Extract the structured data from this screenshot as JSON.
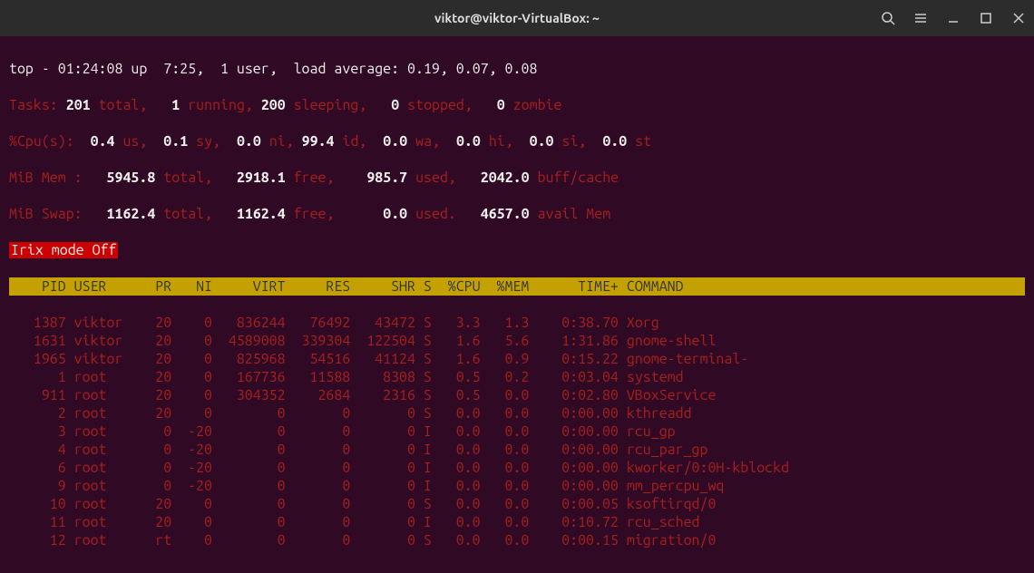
{
  "titlebar": {
    "title": "viktor@viktor-VirtualBox: ~"
  },
  "header": {
    "line1_prefix": "top - 01:24:08 up  7:25,  1 user,  load average: 0.19, 0.07, 0.08",
    "tasks": {
      "label": "Tasks:",
      "total": "201",
      "total_l": "total,",
      "running": "1",
      "running_l": "running,",
      "sleeping": "200",
      "sleeping_l": "sleeping,",
      "stopped": "0",
      "stopped_l": "stopped,",
      "zombie": "0",
      "zombie_l": "zombie"
    },
    "cpu": {
      "label": "%Cpu(s):",
      "us": "0.4",
      "us_l": "us,",
      "sy": "0.1",
      "sy_l": "sy,",
      "ni": "0.0",
      "ni_l": "ni,",
      "id": "99.4",
      "id_l": "id,",
      "wa": "0.0",
      "wa_l": "wa,",
      "hi": "0.0",
      "hi_l": "hi,",
      "si": "0.0",
      "si_l": "si,",
      "st": "0.0",
      "st_l": "st"
    },
    "mem": {
      "label": "MiB Mem :",
      "total": "5945.8",
      "total_l": "total,",
      "free": "2918.1",
      "free_l": "free,",
      "used": "985.7",
      "used_l": "used,",
      "buff": "2042.0",
      "buff_l": "buff/cache"
    },
    "swap": {
      "label": "MiB Swap:",
      "total": "1162.4",
      "total_l": "total,",
      "free": "1162.4",
      "free_l": "free,",
      "used": "0.0",
      "used_l": "used.",
      "avail": "4657.0",
      "avail_l": "avail Mem"
    },
    "irix": "Irix mode Off"
  },
  "columns": {
    "pid": "PID",
    "user": "USER",
    "pr": "PR",
    "ni": "NI",
    "virt": "VIRT",
    "res": "RES",
    "shr": "SHR",
    "s": "S",
    "cpu": "%CPU",
    "mem": "%MEM",
    "time": "TIME+",
    "cmd": "COMMAND"
  },
  "rows": [
    {
      "pid": "1387",
      "user": "viktor",
      "pr": "20",
      "ni": "0",
      "virt": "836244",
      "res": "76492",
      "shr": "43472",
      "s": "S",
      "cpu": "3.3",
      "mem": "1.3",
      "time": "0:38.70",
      "cmd": "Xorg"
    },
    {
      "pid": "1631",
      "user": "viktor",
      "pr": "20",
      "ni": "0",
      "virt": "4589008",
      "res": "339304",
      "shr": "122504",
      "s": "S",
      "cpu": "1.6",
      "mem": "5.6",
      "time": "1:31.86",
      "cmd": "gnome-shell"
    },
    {
      "pid": "1965",
      "user": "viktor",
      "pr": "20",
      "ni": "0",
      "virt": "825968",
      "res": "54516",
      "shr": "41124",
      "s": "S",
      "cpu": "1.6",
      "mem": "0.9",
      "time": "0:15.22",
      "cmd": "gnome-terminal-"
    },
    {
      "pid": "1",
      "user": "root",
      "pr": "20",
      "ni": "0",
      "virt": "167736",
      "res": "11588",
      "shr": "8308",
      "s": "S",
      "cpu": "0.5",
      "mem": "0.2",
      "time": "0:03.04",
      "cmd": "systemd"
    },
    {
      "pid": "911",
      "user": "root",
      "pr": "20",
      "ni": "0",
      "virt": "304352",
      "res": "2684",
      "shr": "2316",
      "s": "S",
      "cpu": "0.5",
      "mem": "0.0",
      "time": "0:02.80",
      "cmd": "VBoxService"
    },
    {
      "pid": "2",
      "user": "root",
      "pr": "20",
      "ni": "0",
      "virt": "0",
      "res": "0",
      "shr": "0",
      "s": "S",
      "cpu": "0.0",
      "mem": "0.0",
      "time": "0:00.00",
      "cmd": "kthreadd"
    },
    {
      "pid": "3",
      "user": "root",
      "pr": "0",
      "ni": "-20",
      "virt": "0",
      "res": "0",
      "shr": "0",
      "s": "I",
      "cpu": "0.0",
      "mem": "0.0",
      "time": "0:00.00",
      "cmd": "rcu_gp"
    },
    {
      "pid": "4",
      "user": "root",
      "pr": "0",
      "ni": "-20",
      "virt": "0",
      "res": "0",
      "shr": "0",
      "s": "I",
      "cpu": "0.0",
      "mem": "0.0",
      "time": "0:00.00",
      "cmd": "rcu_par_gp"
    },
    {
      "pid": "6",
      "user": "root",
      "pr": "0",
      "ni": "-20",
      "virt": "0",
      "res": "0",
      "shr": "0",
      "s": "I",
      "cpu": "0.0",
      "mem": "0.0",
      "time": "0:00.00",
      "cmd": "kworker/0:0H-kblockd"
    },
    {
      "pid": "9",
      "user": "root",
      "pr": "0",
      "ni": "-20",
      "virt": "0",
      "res": "0",
      "shr": "0",
      "s": "I",
      "cpu": "0.0",
      "mem": "0.0",
      "time": "0:00.00",
      "cmd": "mm_percpu_wq"
    },
    {
      "pid": "10",
      "user": "root",
      "pr": "20",
      "ni": "0",
      "virt": "0",
      "res": "0",
      "shr": "0",
      "s": "S",
      "cpu": "0.0",
      "mem": "0.0",
      "time": "0:00.05",
      "cmd": "ksoftirqd/0"
    },
    {
      "pid": "11",
      "user": "root",
      "pr": "20",
      "ni": "0",
      "virt": "0",
      "res": "0",
      "shr": "0",
      "s": "I",
      "cpu": "0.0",
      "mem": "0.0",
      "time": "0:10.72",
      "cmd": "rcu_sched"
    },
    {
      "pid": "12",
      "user": "root",
      "pr": "rt",
      "ni": "0",
      "virt": "0",
      "res": "0",
      "shr": "0",
      "s": "S",
      "cpu": "0.0",
      "mem": "0.0",
      "time": "0:00.15",
      "cmd": "migration/0"
    }
  ]
}
